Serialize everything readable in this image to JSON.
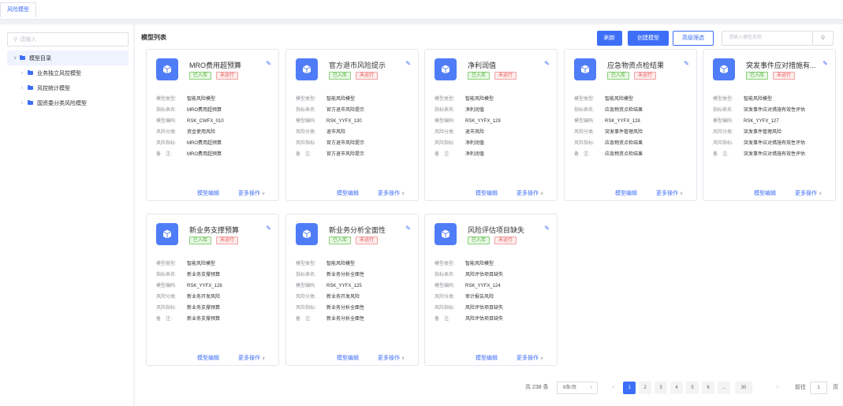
{
  "tabs": [
    {
      "label": "风险模型"
    }
  ],
  "sidebar": {
    "search_placeholder": "请输入",
    "tree": {
      "root_label": "模型目录",
      "children": [
        {
          "label": "业务独立风控模型"
        },
        {
          "label": "风控统计模型"
        },
        {
          "label": "国资委分类风险模型"
        }
      ]
    }
  },
  "main": {
    "title": "模型列表",
    "buttons": {
      "refresh": "刷新",
      "create": "创建模型",
      "advanced_filter": "高级筛选"
    },
    "name_search_placeholder": "请输入模型名称",
    "field_labels": {
      "type": "模型类型:",
      "table_name": "指标表名:",
      "code": "模型编码:",
      "category": "风险分类:",
      "indicator": "风险指标:",
      "remark": "备　注:"
    },
    "tag_labels": {
      "stored": "已入库",
      "not_run": "未运行"
    },
    "card_actions": {
      "edit": "模型编辑",
      "more": "更多操作"
    },
    "cards": [
      {
        "name": "MRO费用超预算",
        "type": "智能风险模型",
        "table_name": "MRO费用超预算",
        "code": "RSK_CWFX_010",
        "category": "资金使用风险",
        "indicator": "MRO费用超预算",
        "remark": "MRO费用超预算"
      },
      {
        "name": "官方退市风险提示",
        "type": "智能风险模型",
        "table_name": "官方退市风险提示",
        "code": "RSK_YYFX_130",
        "category": "退市风险",
        "indicator": "官方退市风险提示",
        "remark": "官方退市风险提示"
      },
      {
        "name": "净利润值",
        "type": "智能风险模型",
        "table_name": "净利润值",
        "code": "RSK_YYFX_129",
        "category": "退市风险",
        "indicator": "净利润值",
        "remark": "净利润值"
      },
      {
        "name": "应急物资点检结果",
        "type": "智能风险模型",
        "table_name": "应急物资点检结果",
        "code": "RSK_YYFX_128",
        "category": "突发事件管理风险",
        "indicator": "应急物资点检结果",
        "remark": "应急物资点检结果"
      },
      {
        "name": "突发事件应对措施有...",
        "type": "智能风险模型",
        "table_name": "突发事件应对措施有效性评估",
        "code": "RSK_YYFX_127",
        "category": "突发事件管理风险",
        "indicator": "突发事件应对措施有效性评估",
        "remark": "突发事件应对措施有效性评估"
      },
      {
        "name": "新业务支撑预算",
        "type": "智能风险模型",
        "table_name": "新业务支撑预算",
        "code": "RSK_YYFX_126",
        "category": "新业务开发风险",
        "indicator": "新业务支撑预算",
        "remark": "新业务支撑预算"
      },
      {
        "name": "新业务分析全面性",
        "type": "智能风险模型",
        "table_name": "新业务分析全面性",
        "code": "RSK_YYFX_125",
        "category": "新业务开发风险",
        "indicator": "新业务分析全面性",
        "remark": "新业务分析全面性"
      },
      {
        "name": "风险评估项目缺失",
        "type": "智能风险模型",
        "table_name": "风险评估项目缺失",
        "code": "RSK_YYFX_124",
        "category": "审计报告风险",
        "indicator": "风险评估项目缺失",
        "remark": "风险评估项目缺失"
      }
    ]
  },
  "pagination": {
    "total": "共 238 条",
    "page_size": "8条/页",
    "prev": "<",
    "next": ">",
    "pages": [
      "1",
      "2",
      "3",
      "4",
      "5",
      "6",
      "...",
      "30"
    ],
    "current": "1",
    "goto_label": "前往",
    "goto_value": "1",
    "goto_unit": "页"
  },
  "colors": {
    "primary": "#3d6ef7",
    "tag_green": "#52b53a",
    "tag_red": "#e85454"
  }
}
